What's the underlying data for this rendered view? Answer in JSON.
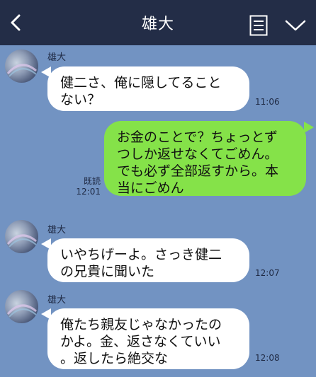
{
  "header": {
    "title": "雄大",
    "back_icon": "chevron-left-icon",
    "notes_icon": "notes-icon",
    "menu_icon": "chevron-down-icon",
    "bg_color": "#232d47"
  },
  "chat": {
    "bg_color": "#7293c2",
    "incoming_bubble_color": "#ffffff",
    "outgoing_bubble_color": "#85e249",
    "messages": [
      {
        "direction": "incoming",
        "sender": "雄大",
        "lines": [
          "健二さ、俺に隠してること",
          "ない？"
        ],
        "time": "11:06"
      },
      {
        "direction": "outgoing",
        "read_label": "既読",
        "lines": [
          "お金のことで？ちょっとず",
          "つしか返せなくてごめん。",
          "でも必ず全部返すから。本",
          "当にごめん"
        ],
        "time": "12:01"
      },
      {
        "direction": "incoming",
        "sender": "雄大",
        "lines": [
          "いやちげーよ。さっき健二",
          "の兄貴に聞いた"
        ],
        "time": "12:07"
      },
      {
        "direction": "incoming",
        "sender": "雄大",
        "lines": [
          "俺たち親友じゃなかったの",
          "かよ。金、返さなくていい",
          "。返したら絶交な"
        ],
        "time": "12:08"
      }
    ]
  }
}
